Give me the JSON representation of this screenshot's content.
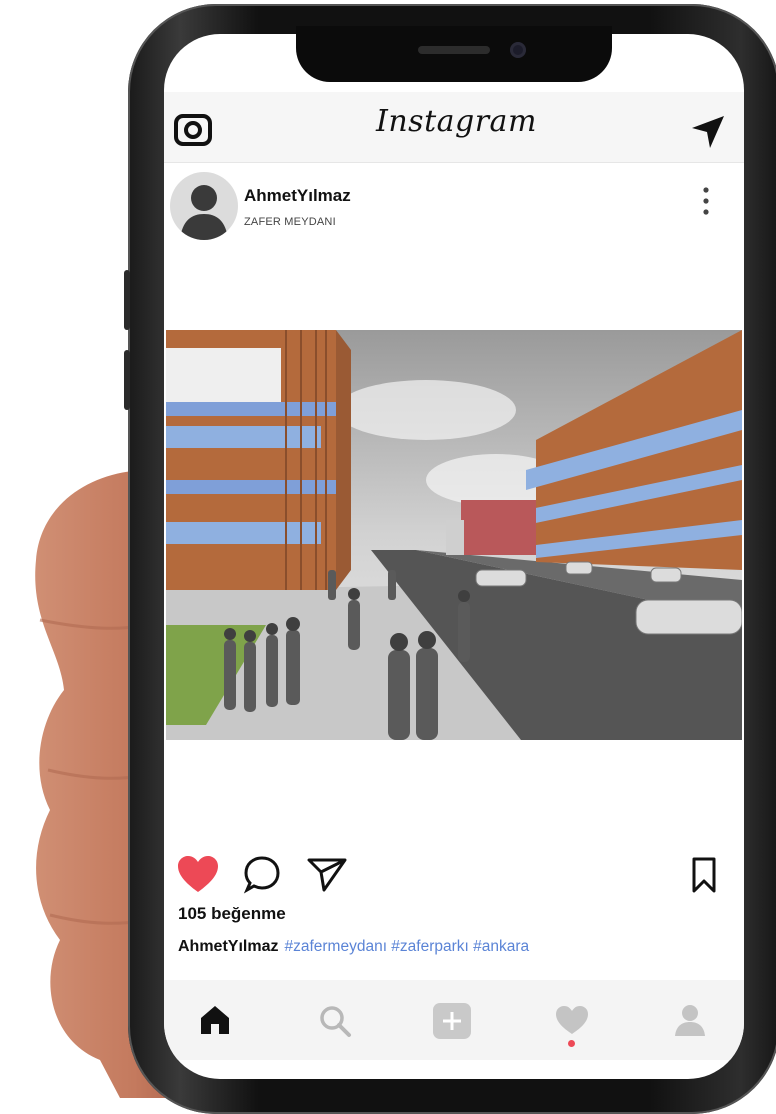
{
  "app": {
    "title": "Instagram"
  },
  "post": {
    "username": "AhmetYılmaz",
    "location": "ZAFER MEYDANI",
    "likes_text": "105 beğenme",
    "caption_username": "AhmetYılmaz",
    "hashtags": "#zafermeydanı #zaferparkı #ankara",
    "liked": true
  },
  "icons": {
    "top_left": "camera-icon",
    "top_right": "direct-message-icon",
    "more": "more-vertical-icon",
    "like": "heart-icon",
    "comment": "comment-icon",
    "share": "share-icon",
    "save": "bookmark-icon",
    "nav": [
      "home-icon",
      "search-icon",
      "add-icon",
      "activity-heart-icon",
      "profile-icon"
    ]
  },
  "colors": {
    "like": "#ed4956",
    "hashtag": "#5b84d6",
    "notification_dot": "#ed4956"
  }
}
